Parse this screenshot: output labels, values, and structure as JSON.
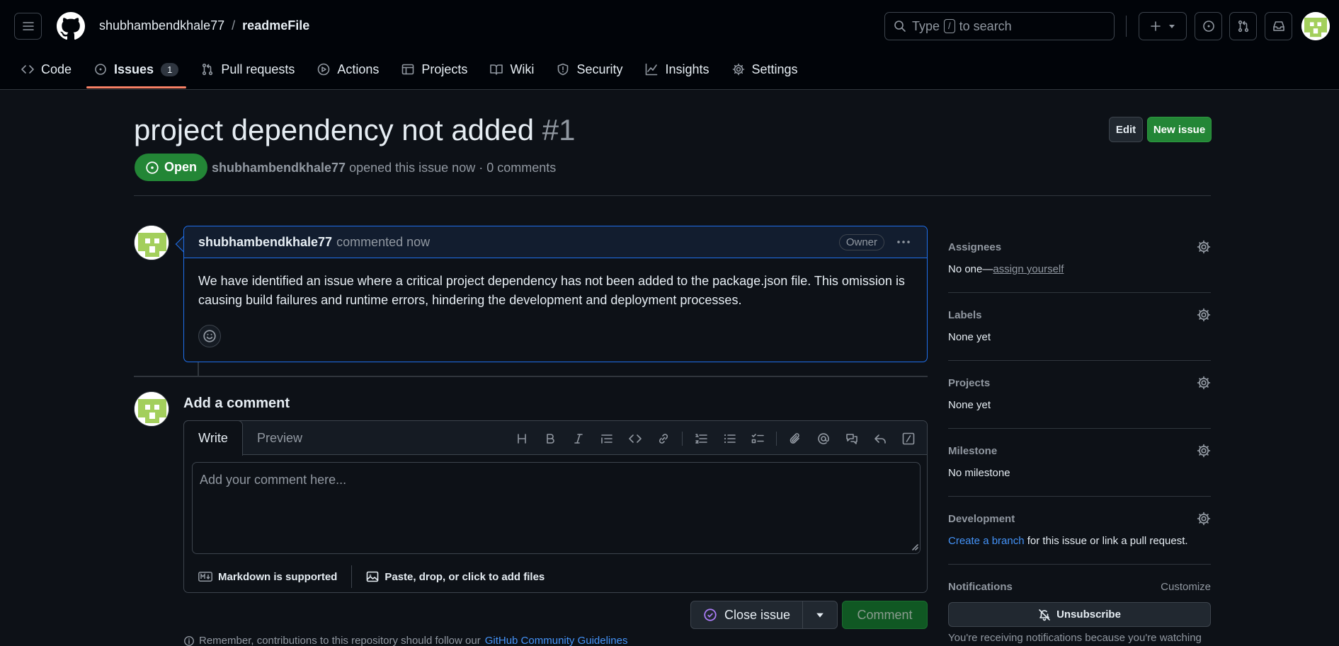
{
  "header": {
    "owner": "shubhambendkhale77",
    "separator": "/",
    "repo": "readmeFile",
    "search_prefix": "Type",
    "search_key": "/",
    "search_suffix": "to search"
  },
  "nav": {
    "code": "Code",
    "issues": "Issues",
    "issues_count": "1",
    "pulls": "Pull requests",
    "actions": "Actions",
    "projects": "Projects",
    "wiki": "Wiki",
    "security": "Security",
    "insights": "Insights",
    "settings": "Settings"
  },
  "issue": {
    "title": "project dependency not added",
    "number": "#1",
    "edit_label": "Edit",
    "new_issue_label": "New issue",
    "state": "Open",
    "author": "shubhambendkhale77",
    "meta_text": "opened this issue now · 0 comments"
  },
  "comment": {
    "author": "shubhambendkhale77",
    "timestamp": "commented now",
    "badge": "Owner",
    "body": "We have identified an issue where a critical project dependency has not been added to the package.json file. This omission is causing build failures and runtime errors, hindering the development and deployment processes."
  },
  "composer": {
    "title": "Add a comment",
    "tab_write": "Write",
    "tab_preview": "Preview",
    "placeholder": "Add your comment here...",
    "markdown_note": "Markdown is supported",
    "attach_note": "Paste, drop, or click to add files",
    "close_label": "Close issue",
    "comment_label": "Comment",
    "guidelines_prefix": "Remember, contributions to this repository should follow our",
    "guidelines_link": "GitHub Community Guidelines"
  },
  "sidebar": {
    "assignees": {
      "label": "Assignees",
      "value_prefix": "No one—",
      "value_link": "assign yourself"
    },
    "labels": {
      "label": "Labels",
      "value": "None yet"
    },
    "projects": {
      "label": "Projects",
      "value": "None yet"
    },
    "milestone": {
      "label": "Milestone",
      "value": "No milestone"
    },
    "development": {
      "label": "Development",
      "link": "Create a branch",
      "suffix": "for this issue or link a pull request."
    },
    "notifications": {
      "label": "Notifications",
      "customize": "Customize",
      "unsubscribe": "Unsubscribe",
      "note": "You're receiving notifications because you're watching"
    }
  },
  "colors": {
    "accent_green": "#238636",
    "link_blue": "#4493f8",
    "underline_orange": "#f78166",
    "avatar_green": "#a3cf5c"
  }
}
